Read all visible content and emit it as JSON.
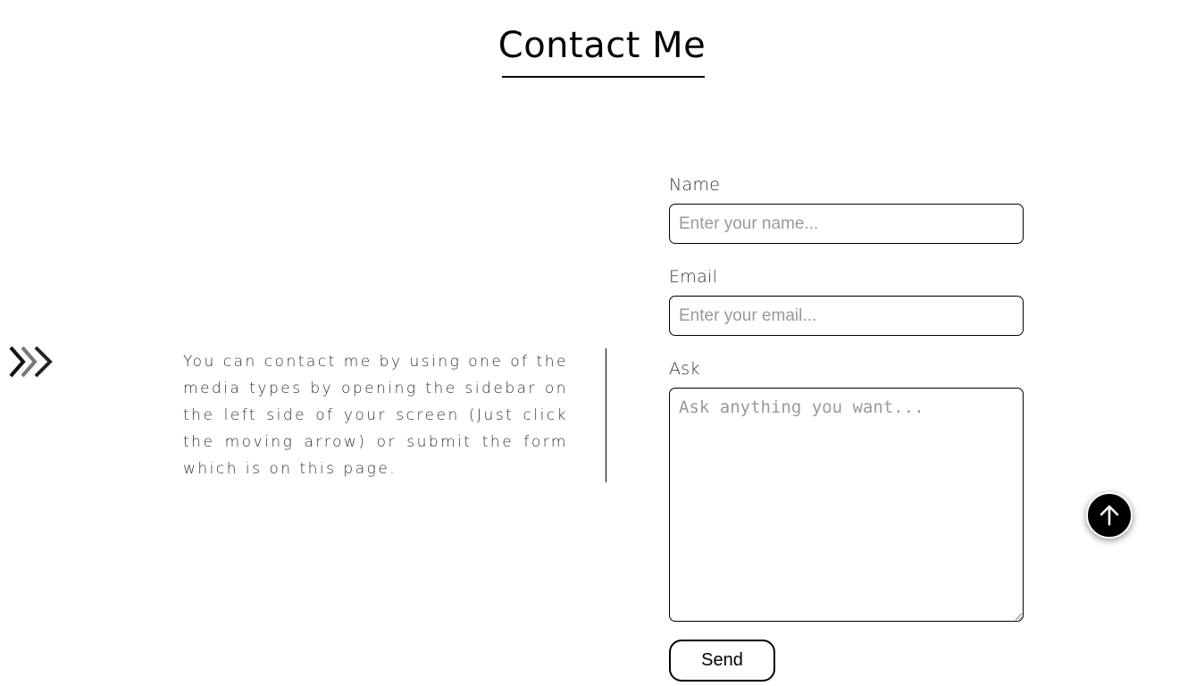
{
  "header": {
    "title": "Contact Me"
  },
  "sidebar_toggle": {
    "icon": "double-chevron-right-icon"
  },
  "intro": {
    "text": "You can contact me by using one of the media types by opening the sidebar on the left side of your screen (Just click the moving arrow) or submit the form which is on this page."
  },
  "form": {
    "name_label": "Name",
    "name_placeholder": "Enter your name...",
    "name_value": "",
    "email_label": "Email",
    "email_placeholder": "Enter your email...",
    "email_value": "",
    "ask_label": "Ask",
    "ask_placeholder": "Ask anything you want...",
    "ask_value": "",
    "send_label": "Send"
  },
  "scroll_top": {
    "icon": "arrow-up-icon"
  },
  "colors": {
    "text": "#000000",
    "muted_text": "#333333",
    "placeholder": "#9a9a9a",
    "background": "#ffffff"
  }
}
